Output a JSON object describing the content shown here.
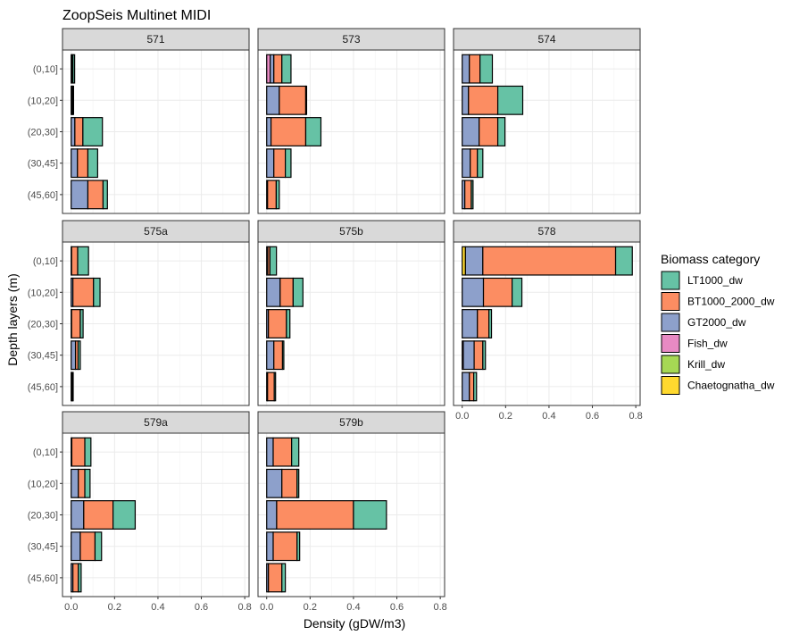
{
  "chart_data": {
    "type": "bar",
    "orientation": "horizontal-stacked",
    "title": "ZoopSeis Multinet MIDI",
    "xlabel": "Density (gDW/m3)",
    "ylabel": "Depth layers (m)",
    "xlim": [
      -0.04,
      0.82
    ],
    "x_ticks": [
      "0.0",
      "0.2",
      "0.4",
      "0.6",
      "0.8"
    ],
    "x_tick_values": [
      0.0,
      0.2,
      0.4,
      0.6,
      0.8
    ],
    "categories": [
      "(0,10]",
      "(10,20]",
      "(20,30]",
      "(30,45]",
      "(45,60]"
    ],
    "grid": true,
    "legend": {
      "title": "Biomass category",
      "placement": "right",
      "entries": [
        {
          "name": "LT1000_dw",
          "color": "#66c2a5"
        },
        {
          "name": "BT1000_2000_dw",
          "color": "#fc8d62"
        },
        {
          "name": "GT2000_dw",
          "color": "#8da0cb"
        },
        {
          "name": "Fish_dw",
          "color": "#e78ac3"
        },
        {
          "name": "Krill_dw",
          "color": "#a6d854"
        },
        {
          "name": "Chaetognatha_dw",
          "color": "#ffd92f"
        }
      ]
    },
    "stack_order": [
      "Chaetognatha_dw",
      "Krill_dw",
      "Fish_dw",
      "GT2000_dw",
      "BT1000_2000_dw",
      "LT1000_dw"
    ],
    "panels": [
      {
        "name": "571",
        "bars": [
          {
            "Chaetognatha_dw": 0.0,
            "Krill_dw": 0.0,
            "Fish_dw": 0.0,
            "GT2000_dw": 0.003,
            "BT1000_2000_dw": 0.005,
            "LT1000_dw": 0.008
          },
          {
            "Chaetognatha_dw": 0.0,
            "Krill_dw": 0.0,
            "Fish_dw": 0.0,
            "GT2000_dw": 0.003,
            "BT1000_2000_dw": 0.004,
            "LT1000_dw": 0.004
          },
          {
            "Chaetognatha_dw": 0.0,
            "Krill_dw": 0.0,
            "Fish_dw": 0.0,
            "GT2000_dw": 0.017,
            "BT1000_2000_dw": 0.037,
            "LT1000_dw": 0.09
          },
          {
            "Chaetognatha_dw": 0.0,
            "Krill_dw": 0.0,
            "Fish_dw": 0.0,
            "GT2000_dw": 0.029,
            "BT1000_2000_dw": 0.048,
            "LT1000_dw": 0.045
          },
          {
            "Chaetognatha_dw": 0.0,
            "Krill_dw": 0.0,
            "Fish_dw": 0.0,
            "GT2000_dw": 0.077,
            "BT1000_2000_dw": 0.07,
            "LT1000_dw": 0.02
          }
        ]
      },
      {
        "name": "573",
        "bars": [
          {
            "Chaetognatha_dw": 0.0,
            "Krill_dw": 0.0,
            "Fish_dw": 0.016,
            "GT2000_dw": 0.017,
            "BT1000_2000_dw": 0.037,
            "LT1000_dw": 0.042
          },
          {
            "Chaetognatha_dw": 0.0,
            "Krill_dw": 0.0,
            "Fish_dw": 0.0,
            "GT2000_dw": 0.058,
            "BT1000_2000_dw": 0.122,
            "LT1000_dw": 0.004
          },
          {
            "Chaetognatha_dw": 0.0,
            "Krill_dw": 0.0,
            "Fish_dw": 0.0,
            "GT2000_dw": 0.02,
            "BT1000_2000_dw": 0.16,
            "LT1000_dw": 0.07
          },
          {
            "Chaetognatha_dw": 0.0,
            "Krill_dw": 0.0,
            "Fish_dw": 0.0,
            "GT2000_dw": 0.033,
            "BT1000_2000_dw": 0.053,
            "LT1000_dw": 0.026
          },
          {
            "Chaetognatha_dw": 0.0,
            "Krill_dw": 0.0,
            "Fish_dw": 0.0,
            "GT2000_dw": 0.004,
            "BT1000_2000_dw": 0.04,
            "LT1000_dw": 0.014
          }
        ]
      },
      {
        "name": "574",
        "bars": [
          {
            "Chaetognatha_dw": 0.0,
            "Krill_dw": 0.0,
            "Fish_dw": 0.0,
            "GT2000_dw": 0.033,
            "BT1000_2000_dw": 0.049,
            "LT1000_dw": 0.057
          },
          {
            "Chaetognatha_dw": 0.0,
            "Krill_dw": 0.0,
            "Fish_dw": 0.0,
            "GT2000_dw": 0.029,
            "BT1000_2000_dw": 0.135,
            "LT1000_dw": 0.115
          },
          {
            "Chaetognatha_dw": 0.0,
            "Krill_dw": 0.0,
            "Fish_dw": 0.0,
            "GT2000_dw": 0.078,
            "BT1000_2000_dw": 0.086,
            "LT1000_dw": 0.033
          },
          {
            "Chaetognatha_dw": 0.0,
            "Krill_dw": 0.0,
            "Fish_dw": 0.0,
            "GT2000_dw": 0.037,
            "BT1000_2000_dw": 0.033,
            "LT1000_dw": 0.025
          },
          {
            "Chaetognatha_dw": 0.0,
            "Krill_dw": 0.0,
            "Fish_dw": 0.0,
            "GT2000_dw": 0.012,
            "BT1000_2000_dw": 0.03,
            "LT1000_dw": 0.008
          }
        ]
      },
      {
        "name": "575a",
        "bars": [
          {
            "Chaetognatha_dw": 0.0,
            "Krill_dw": 0.0,
            "Fish_dw": 0.0,
            "GT2000_dw": 0.002,
            "BT1000_2000_dw": 0.028,
            "LT1000_dw": 0.05
          },
          {
            "Chaetognatha_dw": 0.0,
            "Krill_dw": 0.0,
            "Fish_dw": 0.0,
            "GT2000_dw": 0.008,
            "BT1000_2000_dw": 0.095,
            "LT1000_dw": 0.03
          },
          {
            "Chaetognatha_dw": 0.0,
            "Krill_dw": 0.0,
            "Fish_dw": 0.0,
            "GT2000_dw": 0.002,
            "BT1000_2000_dw": 0.04,
            "LT1000_dw": 0.013
          },
          {
            "Chaetognatha_dw": 0.0,
            "Krill_dw": 0.0,
            "Fish_dw": 0.0,
            "GT2000_dw": 0.02,
            "BT1000_2000_dw": 0.012,
            "LT1000_dw": 0.01
          },
          {
            "Chaetognatha_dw": 0.0,
            "Krill_dw": 0.0,
            "Fish_dw": 0.0,
            "GT2000_dw": 0.003,
            "BT1000_2000_dw": 0.003,
            "LT1000_dw": 0.003
          }
        ]
      },
      {
        "name": "575b",
        "bars": [
          {
            "Chaetognatha_dw": 0.0,
            "Krill_dw": 0.0,
            "Fish_dw": 0.0,
            "GT2000_dw": 0.005,
            "BT1000_2000_dw": 0.01,
            "LT1000_dw": 0.03
          },
          {
            "Chaetognatha_dw": 0.0,
            "Krill_dw": 0.0,
            "Fish_dw": 0.0,
            "GT2000_dw": 0.062,
            "BT1000_2000_dw": 0.06,
            "LT1000_dw": 0.045
          },
          {
            "Chaetognatha_dw": 0.0,
            "Krill_dw": 0.0,
            "Fish_dw": 0.0,
            "GT2000_dw": 0.008,
            "BT1000_2000_dw": 0.083,
            "LT1000_dw": 0.016
          },
          {
            "Chaetognatha_dw": 0.0,
            "Krill_dw": 0.0,
            "Fish_dw": 0.0,
            "GT2000_dw": 0.033,
            "BT1000_2000_dw": 0.04,
            "LT1000_dw": 0.006
          },
          {
            "Chaetognatha_dw": 0.0,
            "Krill_dw": 0.0,
            "Fish_dw": 0.0,
            "GT2000_dw": 0.004,
            "BT1000_2000_dw": 0.031,
            "LT1000_dw": 0.006
          }
        ]
      },
      {
        "name": "578",
        "bars": [
          {
            "Chaetognatha_dw": 0.015,
            "Krill_dw": 0.0,
            "Fish_dw": 0.0,
            "GT2000_dw": 0.08,
            "BT1000_2000_dw": 0.612,
            "LT1000_dw": 0.077
          },
          {
            "Chaetognatha_dw": 0.0,
            "Krill_dw": 0.0,
            "Fish_dw": 0.0,
            "GT2000_dw": 0.098,
            "BT1000_2000_dw": 0.132,
            "LT1000_dw": 0.045
          },
          {
            "Chaetognatha_dw": 0.0,
            "Krill_dw": 0.0,
            "Fish_dw": 0.0,
            "GT2000_dw": 0.07,
            "BT1000_2000_dw": 0.053,
            "LT1000_dw": 0.012
          },
          {
            "Chaetognatha_dw": 0.0,
            "Krill_dw": 0.0,
            "Fish_dw": 0.005,
            "GT2000_dw": 0.05,
            "BT1000_2000_dw": 0.04,
            "LT1000_dw": 0.012
          },
          {
            "Chaetognatha_dw": 0.0,
            "Krill_dw": 0.0,
            "Fish_dw": 0.0,
            "GT2000_dw": 0.033,
            "BT1000_2000_dw": 0.02,
            "LT1000_dw": 0.013
          }
        ]
      },
      {
        "name": "579a",
        "bars": [
          {
            "Chaetognatha_dw": 0.0,
            "Krill_dw": 0.0,
            "Fish_dw": 0.0,
            "GT2000_dw": 0.003,
            "BT1000_2000_dw": 0.06,
            "LT1000_dw": 0.028
          },
          {
            "Chaetognatha_dw": 0.0,
            "Krill_dw": 0.0,
            "Fish_dw": 0.0,
            "GT2000_dw": 0.033,
            "BT1000_2000_dw": 0.03,
            "LT1000_dw": 0.024
          },
          {
            "Chaetognatha_dw": 0.0,
            "Krill_dw": 0.0,
            "Fish_dw": 0.0,
            "GT2000_dw": 0.058,
            "BT1000_2000_dw": 0.135,
            "LT1000_dw": 0.102
          },
          {
            "Chaetognatha_dw": 0.0,
            "Krill_dw": 0.0,
            "Fish_dw": 0.0,
            "GT2000_dw": 0.042,
            "BT1000_2000_dw": 0.068,
            "LT1000_dw": 0.03
          },
          {
            "Chaetognatha_dw": 0.0,
            "Krill_dw": 0.0,
            "Fish_dw": 0.0,
            "GT2000_dw": 0.008,
            "BT1000_2000_dw": 0.025,
            "LT1000_dw": 0.013
          }
        ]
      },
      {
        "name": "579b",
        "bars": [
          {
            "Chaetognatha_dw": 0.0,
            "Krill_dw": 0.0,
            "Fish_dw": 0.0,
            "GT2000_dw": 0.03,
            "BT1000_2000_dw": 0.085,
            "LT1000_dw": 0.033
          },
          {
            "Chaetognatha_dw": 0.0,
            "Krill_dw": 0.0,
            "Fish_dw": 0.0,
            "GT2000_dw": 0.07,
            "BT1000_2000_dw": 0.07,
            "LT1000_dw": 0.008
          },
          {
            "Chaetognatha_dw": 0.0,
            "Krill_dw": 0.0,
            "Fish_dw": 0.0,
            "GT2000_dw": 0.046,
            "BT1000_2000_dw": 0.354,
            "LT1000_dw": 0.152
          },
          {
            "Chaetognatha_dw": 0.0,
            "Krill_dw": 0.0,
            "Fish_dw": 0.0,
            "GT2000_dw": 0.03,
            "BT1000_2000_dw": 0.11,
            "LT1000_dw": 0.012
          },
          {
            "Chaetognatha_dw": 0.0,
            "Krill_dw": 0.0,
            "Fish_dw": 0.0,
            "GT2000_dw": 0.008,
            "BT1000_2000_dw": 0.062,
            "LT1000_dw": 0.016
          }
        ]
      }
    ]
  }
}
